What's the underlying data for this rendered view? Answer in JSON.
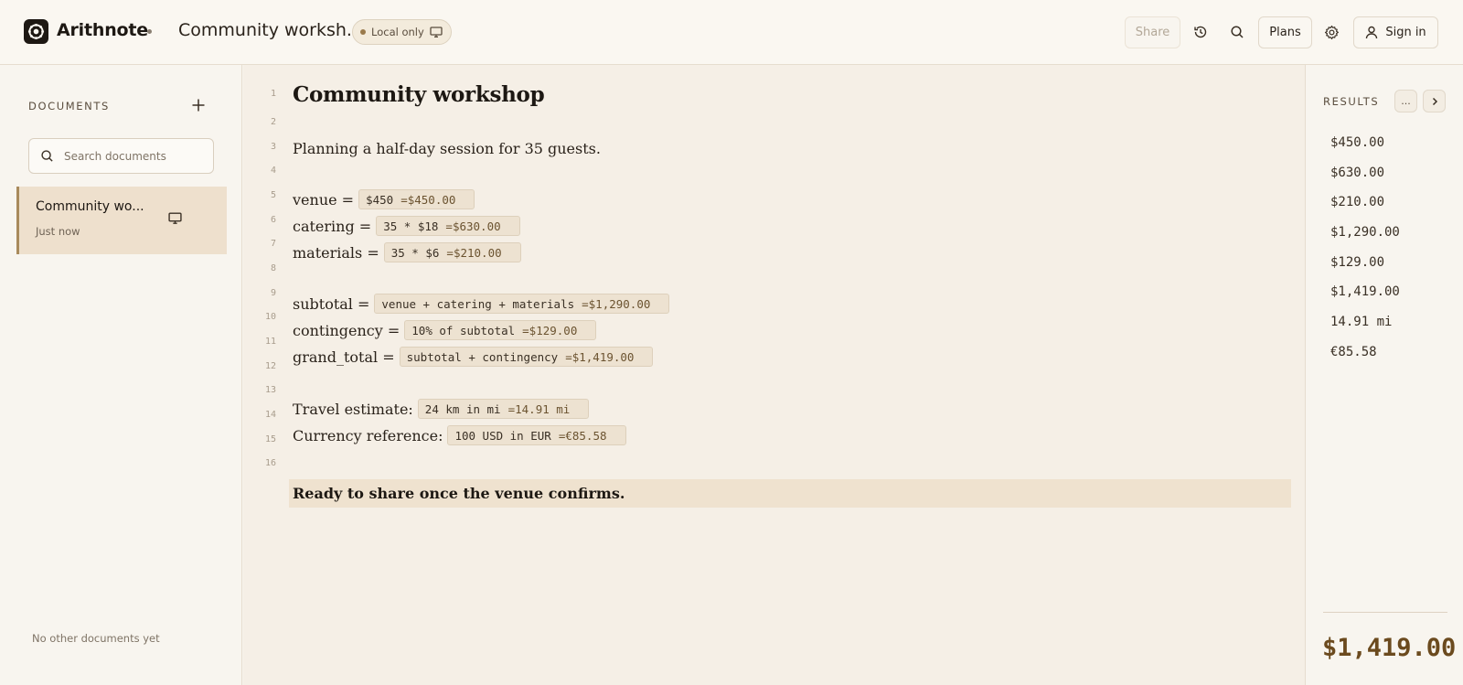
{
  "header": {
    "app_name": "Arithnote",
    "doc_title": "Community worksh...",
    "badge_label": "Local only",
    "share_label": "Share",
    "plans_label": "Plans",
    "signin_label": "Sign in"
  },
  "sidebar": {
    "title": "DOCUMENTS",
    "search_placeholder": "Search documents",
    "items": [
      {
        "title": "Community wo...",
        "time": "Just now"
      }
    ],
    "empty_text": "No other documents yet"
  },
  "editor": {
    "line_numbers": [
      "1",
      "2",
      "3",
      "4",
      "5",
      "6",
      "7",
      "8",
      "9",
      "10",
      "11",
      "12",
      "13",
      "14",
      "15",
      "16"
    ],
    "heading": "Community workshop",
    "intro": "Planning a half-day session for 35 guests.",
    "rows": [
      {
        "label": "venue =",
        "expr": "$450",
        "result": "=$450.00"
      },
      {
        "label": "catering =",
        "expr": "35 * $18",
        "result": "=$630.00"
      },
      {
        "label": "materials =",
        "expr": "35 * $6",
        "result": "=$210.00"
      },
      {
        "label": "subtotal =",
        "expr": "venue + catering + materials",
        "result": "=$1,290.00"
      },
      {
        "label": "contingency =",
        "expr": "10% of subtotal",
        "result": "=$129.00"
      },
      {
        "label": "grand_total =",
        "expr": "subtotal + contingency",
        "result": "=$1,419.00"
      },
      {
        "label": "Travel estimate:",
        "expr": "24 km in mi",
        "result": "=14.91 mi"
      },
      {
        "label": "Currency reference:",
        "expr": "100 USD in EUR",
        "result": "=€85.58"
      }
    ],
    "closing": "Ready to share once the venue confirms."
  },
  "results": {
    "title": "RESULTS",
    "more_label": "...",
    "values": [
      "$450.00",
      "$630.00",
      "$210.00",
      "$1,290.00",
      "$129.00",
      "$1,419.00",
      "14.91 mi",
      "€85.58"
    ],
    "total": "$1,419.00"
  },
  "colors": {
    "accent": "#a98a5c",
    "total": "#6b4a1e",
    "background": "#f5efe6"
  }
}
